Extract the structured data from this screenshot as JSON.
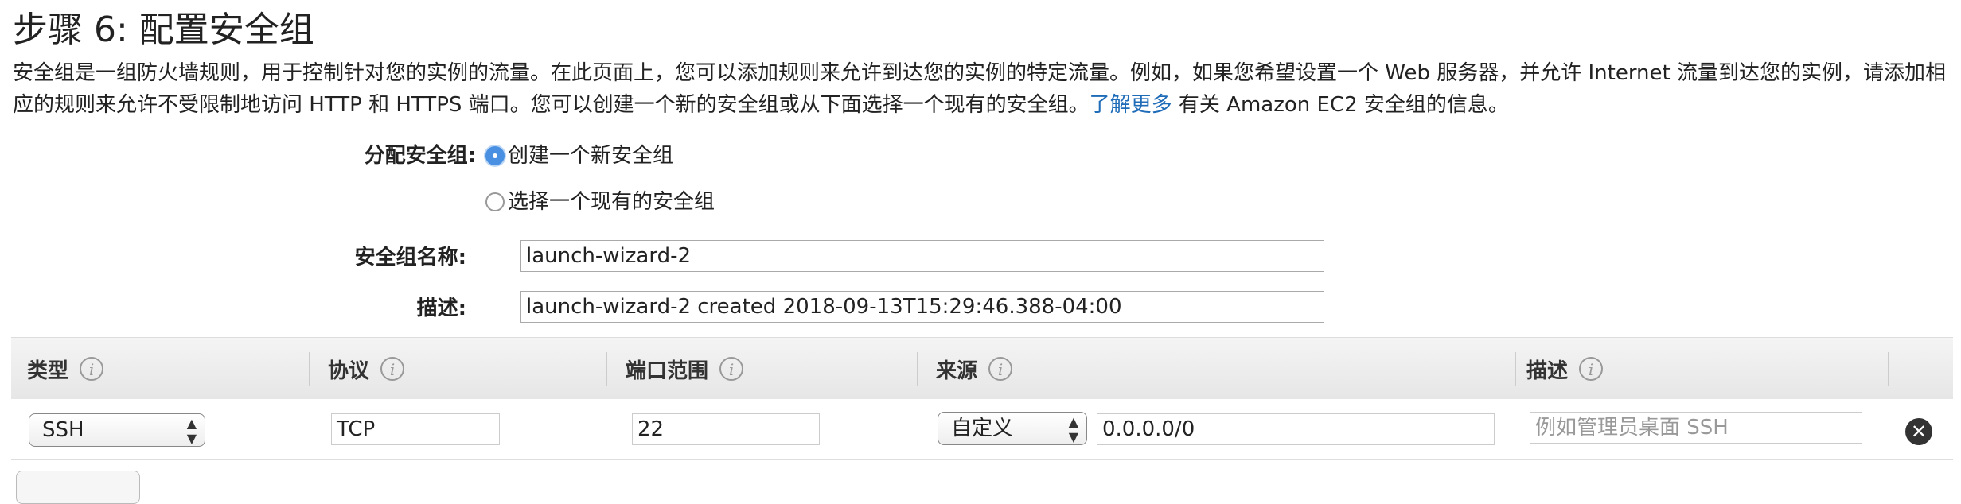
{
  "page": {
    "title": "步骤 6: 配置安全组",
    "description": {
      "text_before_link": "安全组是一组防火墙规则，用于控制针对您的实例的流量。在此页面上，您可以添加规则来允许到达您的实例的特定流量。例如，如果您希望设置一个 Web 服务器，并允许 Internet 流量到达您的实例，请添加相应的规则来允许不受限制地访问 HTTP 和 HTTPS 端口。您可以创建一个新的安全组或从下面选择一个现有的安全组。",
      "link_text": "了解更多",
      "text_after_link": " 有关 Amazon EC2 安全组的信息。"
    }
  },
  "form": {
    "assign_label": "分配安全组:",
    "radio_new_label": "创建一个新安全组",
    "radio_existing_label": "选择一个现有的安全组",
    "name_label": "安全组名称:",
    "name_value": "launch-wizard-2",
    "desc_label": "描述:",
    "desc_value": "launch-wizard-2 created 2018-09-13T15:29:46.388-04:00"
  },
  "table": {
    "headers": {
      "type": "类型",
      "protocol": "协议",
      "port_range": "端口范围",
      "source": "来源",
      "description": "描述"
    },
    "info_glyph": "i",
    "row": {
      "type": "SSH",
      "protocol": "TCP",
      "port": "22",
      "source_type": "自定义",
      "source_cidr": "0.0.0.0/0",
      "description_placeholder": "例如管理员桌面 SSH"
    },
    "select_arrows": "▲▼",
    "remove_glyph": "✕"
  },
  "colors": {
    "link": "#1e6bb8",
    "radio_selected": "#4a90e2",
    "header_bg": "#eeeeee"
  },
  "icons": {
    "info": "info-icon",
    "remove": "remove-circle-icon",
    "select": "up-down-arrows-icon"
  }
}
